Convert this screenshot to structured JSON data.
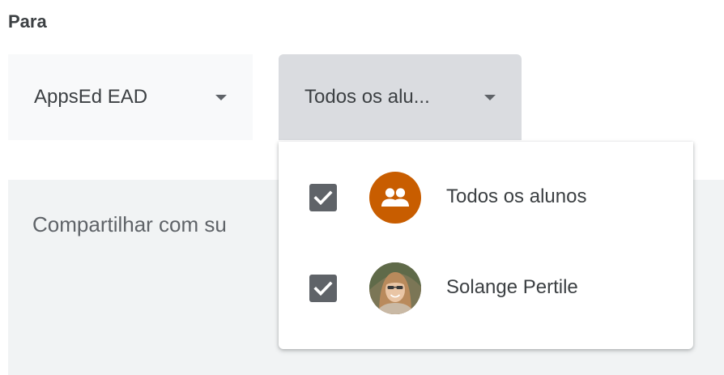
{
  "form": {
    "to_label": "Para"
  },
  "class_select": {
    "value": "AppsEd EAD"
  },
  "students_select": {
    "value": "Todos os alu..."
  },
  "share_field": {
    "placeholder": "Compartilhar com su"
  },
  "students_menu": {
    "items": [
      {
        "label": "Todos os alunos",
        "checked": true,
        "avatar": "group-icon"
      },
      {
        "label": "Solange Pertile",
        "checked": true,
        "avatar": "user-photo"
      }
    ]
  },
  "colors": {
    "group_avatar": "#c85d00",
    "checkbox": "#5f6368",
    "selected_dropdown_bg": "#dadce0"
  }
}
